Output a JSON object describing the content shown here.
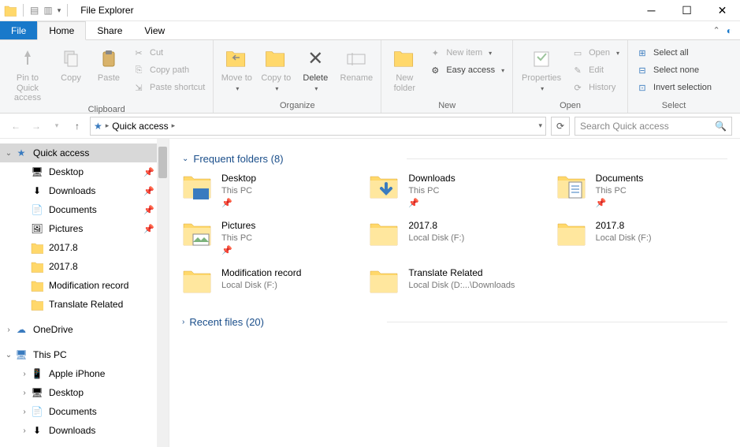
{
  "title": "File Explorer",
  "tabs": {
    "file": "File",
    "home": "Home",
    "share": "Share",
    "view": "View"
  },
  "ribbon": {
    "clipboard": {
      "label": "Clipboard",
      "pin": "Pin to Quick access",
      "copy": "Copy",
      "paste": "Paste",
      "cut": "Cut",
      "copypath": "Copy path",
      "shortcut": "Paste shortcut"
    },
    "organize": {
      "label": "Organize",
      "moveto": "Move to",
      "copyto": "Copy to",
      "delete": "Delete",
      "rename": "Rename"
    },
    "new": {
      "label": "New",
      "newfolder": "New folder",
      "newitem": "New item",
      "easyaccess": "Easy access"
    },
    "open": {
      "label": "Open",
      "properties": "Properties",
      "open": "Open",
      "edit": "Edit",
      "history": "History"
    },
    "select": {
      "label": "Select",
      "all": "Select all",
      "none": "Select none",
      "invert": "Invert selection"
    }
  },
  "address": {
    "root": "Quick access"
  },
  "search": {
    "placeholder": "Search Quick access"
  },
  "sidebar": {
    "quickaccess": "Quick access",
    "items": [
      {
        "label": "Desktop",
        "pin": true
      },
      {
        "label": "Downloads",
        "pin": true
      },
      {
        "label": "Documents",
        "pin": true
      },
      {
        "label": "Pictures",
        "pin": true
      },
      {
        "label": "2017.8",
        "pin": false
      },
      {
        "label": "2017.8",
        "pin": false
      },
      {
        "label": "Modification record",
        "pin": false
      },
      {
        "label": "Translate Related",
        "pin": false
      }
    ],
    "onedrive": "OneDrive",
    "thispc": "This PC",
    "pcitems": [
      "Apple iPhone",
      "Desktop",
      "Documents",
      "Downloads"
    ]
  },
  "sections": {
    "frequent": {
      "title": "Frequent folders (8)"
    },
    "recent": {
      "title": "Recent files (20)"
    }
  },
  "folders": [
    {
      "name": "Desktop",
      "loc": "This PC",
      "pin": true,
      "icon": "desktop"
    },
    {
      "name": "Downloads",
      "loc": "This PC",
      "pin": true,
      "icon": "downloads"
    },
    {
      "name": "Documents",
      "loc": "This PC",
      "pin": true,
      "icon": "documents"
    },
    {
      "name": "Pictures",
      "loc": "This PC",
      "pin": true,
      "icon": "pictures"
    },
    {
      "name": "2017.8",
      "loc": "Local Disk (F:)",
      "pin": false,
      "icon": "folder"
    },
    {
      "name": "2017.8",
      "loc": "Local Disk (F:)",
      "pin": false,
      "icon": "folder"
    },
    {
      "name": "Modification record",
      "loc": "Local Disk (F:)",
      "pin": false,
      "icon": "folder"
    },
    {
      "name": "Translate Related",
      "loc": "Local Disk (D:...\\Downloads",
      "pin": false,
      "icon": "folder"
    }
  ]
}
